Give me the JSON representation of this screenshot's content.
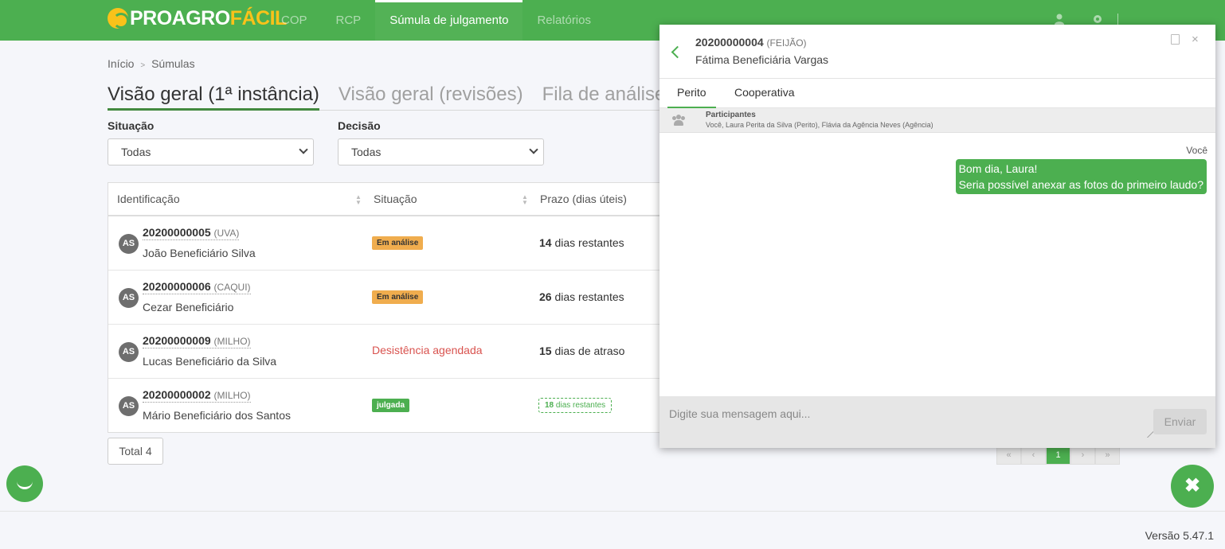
{
  "brand": {
    "part1": "PROAGRO",
    "part2": "FÁCIL"
  },
  "nav": [
    {
      "label": "COP"
    },
    {
      "label": "RCP"
    },
    {
      "label": "Súmula de julgamento"
    },
    {
      "label": "Relatórios"
    }
  ],
  "breadcrumb": {
    "home": "Início",
    "sep": ">",
    "current": "Súmulas"
  },
  "tabs": [
    {
      "label": "Visão geral (1ª instância)"
    },
    {
      "label": "Visão geral (revisões)"
    },
    {
      "label": "Fila de análise"
    }
  ],
  "filters": {
    "situacao": {
      "label": "Situação",
      "value": "Todas"
    },
    "decisao": {
      "label": "Decisão",
      "value": "Todas"
    }
  },
  "table": {
    "headers": {
      "identificacao": "Identificação",
      "situacao": "Situação",
      "prazo": "Prazo (dias úteis)"
    },
    "rows": [
      {
        "avatar": "AS",
        "id": "20200000005",
        "crop": "(UVA)",
        "name": "João Beneficiário Silva",
        "status": "Em análise",
        "prazo_num": "14",
        "prazo_text": "dias restantes"
      },
      {
        "avatar": "AS",
        "id": "20200000006",
        "crop": "(CAQUI)",
        "name": "Cezar Beneficiário",
        "status": "Em análise",
        "prazo_num": "26",
        "prazo_text": "dias restantes"
      },
      {
        "avatar": "AS",
        "id": "20200000009",
        "crop": "(MILHO)",
        "name": "Lucas Beneficiário da Silva",
        "status": "Desistência agendada",
        "prazo_num": "15",
        "prazo_text": "dias de atraso"
      },
      {
        "avatar": "AS",
        "id": "20200000002",
        "crop": "(MILHO)",
        "name": "Mário Beneficiário dos Santos",
        "status": "julgada",
        "prazo_num": "18",
        "prazo_text": "dias restantes"
      }
    ]
  },
  "total": "Total 4",
  "pagination": {
    "first": "«",
    "prev": "‹",
    "current": "1",
    "next": "›",
    "last": "»"
  },
  "chat": {
    "id": "20200000004",
    "crop": "(FEIJÃO)",
    "name": "Fátima Beneficiária Vargas",
    "close": "×",
    "tabs": [
      {
        "label": "Perito"
      },
      {
        "label": "Cooperativa"
      }
    ],
    "participants_title": "Participantes",
    "participants": "Você, Laura Perita da Silva (Perito), Flávia da Agência Neves (Agência)",
    "messages": [
      {
        "sender": "Você",
        "line1": "Bom dia, Laura!",
        "line2": "Seria possível anexar as fotos do primeiro laudo?"
      }
    ],
    "input_placeholder": "Digite sua mensagem aqui...",
    "send_label": "Enviar"
  },
  "close_fab": "✖",
  "version": "Versão 5.47.1",
  "colors": {
    "brand_green": "#4caf50",
    "brand_yellow": "#f9c21a",
    "badge_orange": "#f0ad4e",
    "status_red": "#d9534f"
  },
  "icons": {
    "user": "user-icon",
    "settings": "gear-icon",
    "participants": "people-icon",
    "pdf": "pdf-icon"
  }
}
